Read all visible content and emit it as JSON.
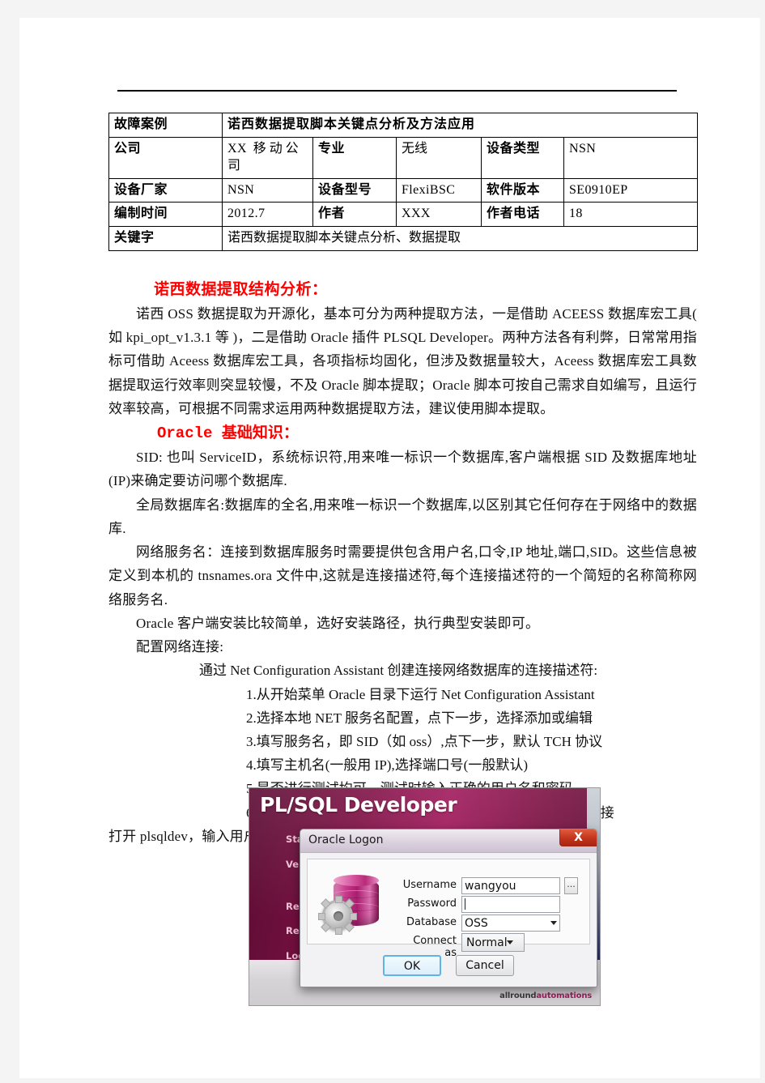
{
  "document": {
    "info_table": {
      "rows": [
        {
          "cells": [
            {
              "text": "故障案例",
              "style": "label"
            },
            {
              "text": "诺西数据提取脚本关键点分析及方法应用",
              "style": "title"
            }
          ]
        },
        {
          "cells": [
            {
              "text": "公司",
              "style": "label"
            },
            {
              "text": "XX 移动公司",
              "style": "value"
            },
            {
              "text": "专业",
              "style": "label"
            },
            {
              "text": "无线",
              "style": "value-cjk"
            },
            {
              "text": "设备类型",
              "style": "label"
            },
            {
              "text": "NSN",
              "style": "value"
            }
          ]
        },
        {
          "cells": [
            {
              "text": "设备厂家",
              "style": "label"
            },
            {
              "text": "NSN",
              "style": "value"
            },
            {
              "text": "设备型号",
              "style": "label"
            },
            {
              "text": "FlexiBSC",
              "style": "value"
            },
            {
              "text": "软件版本",
              "style": "label"
            },
            {
              "text": "SE0910EP",
              "style": "value"
            }
          ]
        },
        {
          "cells": [
            {
              "text": "编制时间",
              "style": "label"
            },
            {
              "text": "2012.7",
              "style": "value"
            },
            {
              "text": "作者",
              "style": "label"
            },
            {
              "text": "XXX",
              "style": "value"
            },
            {
              "text": "作者电话",
              "style": "label"
            },
            {
              "text": "18",
              "style": "value"
            }
          ]
        },
        {
          "cells": [
            {
              "text": "关键字",
              "style": "label"
            },
            {
              "text": "诺西数据提取脚本关键点分析、数据提取",
              "style": "value-cjk"
            }
          ]
        }
      ]
    },
    "headings": {
      "section1": "诺西数据提取结构分析：",
      "section2": "Oracle 基础知识："
    },
    "paragraphs": {
      "p1": "诺西 OSS 数据提取为开源化，基本可分为两种提取方法，一是借助 ACEESS 数据库宏工具( 如 kpi_opt_v1.3.1 等 )，二是借助 Oracle 插件 PLSQL Developer。两种方法各有利弊，日常常用指标可借助 Aceess 数据库宏工具，各项指标均固化，但涉及数据量较大，Aceess 数据库宏工具数据提取运行效率则突显较慢，不及 Oracle 脚本提取；Oracle 脚本可按自己需求自如编写，且运行效率较高，可根据不同需求运用两种数据提取方法，建议使用脚本提取。",
      "p2": "SID: 也叫 ServiceID，系统标识符,用来唯一标识一个数据库,客户端根据 SID 及数据库地址(IP)来确定要访问哪个数据库.",
      "p3": "全局数据库名:数据库的全名,用来唯一标识一个数据库,以区别其它任何存在于网络中的数据库.",
      "p4": "网络服务名：连接到数据库服务时需要提供包含用户名,口令,IP 地址,端口,SID。这些信息被定义到本机的 tnsnames.ora 文件中,这就是连接描述符,每个连接描述符的一个简短的名称简称网络服务名.",
      "p5": "Oracle 客户端安装比较简单，选好安装路径，执行典型安装即可。",
      "p6": "配置网络连接:",
      "p7": "通过 Net Configuration Assistant 创建连接网络数据库的连接描述符:",
      "p8": "打开 plsqldev，输入用户名、密码，选择自定义的网络服务名进入。"
    },
    "steps": [
      "1.从开始菜单 Oracle 目录下运行 Net Configuration Assistant",
      "2.选择本地 NET 服务名配置，点下一步，选择添加或编辑",
      "3.填写服务名，即 SID（如 oss）,点下一步，默认 TCH 协议",
      "4.填写主机名(一般用 IP),选择端口号(一般默认)",
      "5.是否进行测试均可，测试时输入正确的用户名和密码",
      "6.最后输入网络服务名（自定义即可，一般用于区分多个连接"
    ]
  },
  "screenshot": {
    "splash": {
      "title": "PL/SQL Developer",
      "log_line1": "Starting",
      "log_line2": "Version 9",
      "log_line3": "Reading",
      "log_line4": "Reading",
      "log_line5": "Logging",
      "brand_prefix": "allround",
      "brand_suffix": "automations"
    },
    "dialog": {
      "title": "Oracle Logon",
      "close_label": "X",
      "fields": {
        "username_label": "Username",
        "username_value": "wangyou",
        "password_label": "Password",
        "password_value": "",
        "database_label": "Database",
        "database_value": "OSS",
        "connect_as_label": "Connect as",
        "connect_as_value": "Normal",
        "browse_label": "..."
      },
      "buttons": {
        "ok": "OK",
        "cancel": "Cancel"
      }
    }
  },
  "colors": {
    "heading_red": "#ff0000",
    "table_title_blue": "#2222cc",
    "splash_magenta": "#a01a5c",
    "dialog_close_red": "#c2341b"
  }
}
